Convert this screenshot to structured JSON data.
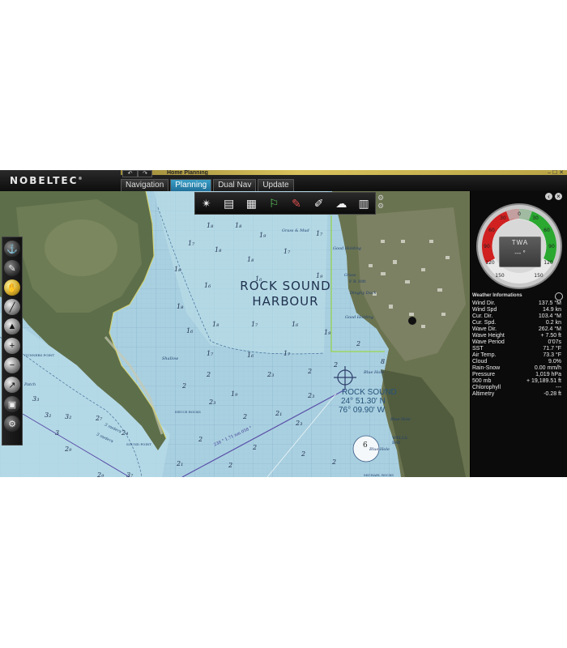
{
  "app": {
    "brand": "NOBELTEC",
    "brand_mark": "®",
    "undo_label": "↶",
    "redo_label": "↷",
    "window_title": "Home Planning",
    "window_controls": "– ☐ ✕"
  },
  "tabs": [
    {
      "label": "Navigation",
      "active": false
    },
    {
      "label": "Planning",
      "active": true
    },
    {
      "label": "Dual Nav",
      "active": false
    },
    {
      "label": "Update",
      "active": false
    }
  ],
  "toolbar": {
    "tools": [
      {
        "icon": "compass-rose-icon",
        "glyph": "✴"
      },
      {
        "icon": "logbook-icon",
        "glyph": "▤"
      },
      {
        "icon": "chart-layers-icon",
        "glyph": "▦"
      },
      {
        "icon": "route-waypoint-icon",
        "glyph": "⚐"
      },
      {
        "icon": "pencil-draw-icon",
        "glyph": "✎"
      },
      {
        "icon": "measure-tool-icon",
        "glyph": "✐"
      },
      {
        "icon": "weather-cloud-icon",
        "glyph": "☁"
      },
      {
        "icon": "data-table-icon",
        "glyph": "▥"
      }
    ],
    "settings_icon": "gear-icon"
  },
  "map": {
    "harbour_line1": "ROCK SOUND",
    "harbour_line2": "HARBOUR",
    "marker_name": "ROCK SOUND",
    "marker_lat": "24° 51.30' N",
    "marker_lon": "76° 09.90' W",
    "labels": {
      "grass_mud": "Grass & Mud",
      "good_holding_1": "Good Holding",
      "good_holding_2": "Good Holding",
      "dinghy_dock": "Dinghy Dock",
      "grass": "Grass",
      "fr": "F R 30ft",
      "blue_hole_1": "Blue Hole",
      "blue_hole_2": "Blue Hole",
      "blue_hole_3": "Blue Hole",
      "wells_bay": "WELLS BAY",
      "shallow": "Shallow",
      "gunners_point": "GUNNERS POINT",
      "patch": "Patch",
      "sound_point": "SOUND POINT",
      "deuce_rocks": "DEUCE ROCKS",
      "three_meters_1": "3 meters",
      "three_meters_2": "3 meters",
      "michael_rocks": "MICHAEL ROCKS",
      "bearing_line": "238 ° 1.71 nm 058 °",
      "hole_depth": "6"
    }
  },
  "left_tools": [
    {
      "icon": "anchor-lock-icon",
      "glyph": "⚓"
    },
    {
      "icon": "pen-tool-icon",
      "glyph": "✎"
    },
    {
      "icon": "brush-tool-icon",
      "glyph": "✋"
    },
    {
      "icon": "ruler-tool-icon",
      "glyph": "╱"
    },
    {
      "icon": "north-up-icon",
      "glyph": "▲"
    },
    {
      "icon": "zoom-in-icon",
      "glyph": "+"
    },
    {
      "icon": "zoom-out-icon",
      "glyph": "−"
    },
    {
      "icon": "track-icon",
      "glyph": "↗"
    },
    {
      "icon": "screen-layout-icon",
      "glyph": "▣"
    },
    {
      "icon": "settings-icon",
      "glyph": "⚙"
    }
  ],
  "gauge": {
    "title": "TWA",
    "value": "--- °",
    "port_color": "#d02020",
    "starboard_color": "#2aa830",
    "ticks": [
      "0",
      "30",
      "30",
      "60",
      "60",
      "90",
      "90",
      "120",
      "120",
      "150",
      "150"
    ]
  },
  "weather": {
    "title": "Weather Informations",
    "rows": [
      {
        "label": "Wind Dir.",
        "value": "137.5 °M"
      },
      {
        "label": "Wind Spd",
        "value": "14.9 kn"
      },
      {
        "label": "Cur. Dir.",
        "value": "103.4 °M"
      },
      {
        "label": "Cur. Spd.",
        "value": "0.2 kn"
      },
      {
        "label": "Wave Dir.",
        "value": "262.4 °M"
      },
      {
        "label": "Wave Height",
        "value": "+ 7.50 ft"
      },
      {
        "label": "Wave Period",
        "value": "0'07s"
      },
      {
        "label": "SST",
        "value": "71.7 °F"
      },
      {
        "label": "Air Temp.",
        "value": "73.3 °F"
      },
      {
        "label": "Cloud",
        "value": "9.0%"
      },
      {
        "label": "Rain-Snow",
        "value": "0.00 mm/h"
      },
      {
        "label": "Pressure",
        "value": "1,019 hPa"
      },
      {
        "label": "500 mb",
        "value": "+ 19,189.51 ft"
      },
      {
        "label": "Chlorophyll",
        "value": "---"
      },
      {
        "label": "Altimetry",
        "value": "-0.28 ft"
      }
    ]
  }
}
